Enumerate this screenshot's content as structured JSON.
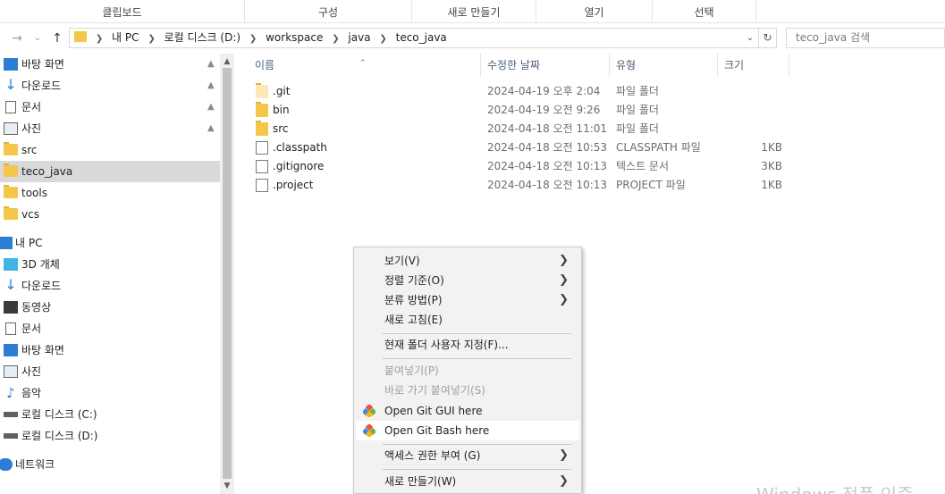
{
  "ribbon": {
    "groups": [
      "클립보드",
      "구성",
      "새로 만들기",
      "열기",
      "선택"
    ]
  },
  "address": {
    "back_icon": "left-arrow-icon",
    "forward_icon": "right-arrow-icon",
    "recent_icon": "chevron-down-icon",
    "up_icon": "up-arrow-icon",
    "crumbs": [
      "내 PC",
      "로컬 디스크 (D:)",
      "workspace",
      "java",
      "teco_java"
    ],
    "search_placeholder": "teco_java 검색"
  },
  "nav": {
    "quick_access": [
      {
        "label": "바탕 화면",
        "icon": "desktop-icon",
        "pinned": true
      },
      {
        "label": "다운로드",
        "icon": "download-icon",
        "pinned": true
      },
      {
        "label": "문서",
        "icon": "documents-icon",
        "pinned": true
      },
      {
        "label": "사진",
        "icon": "pictures-icon",
        "pinned": true
      },
      {
        "label": "src",
        "icon": "folder-icon",
        "pinned": false
      },
      {
        "label": "teco_java",
        "icon": "folder-icon",
        "pinned": false,
        "selected": true
      },
      {
        "label": "tools",
        "icon": "folder-icon",
        "pinned": false
      },
      {
        "label": "vcs",
        "icon": "folder-icon",
        "pinned": false
      }
    ],
    "this_pc": {
      "label": "내 PC",
      "icon": "computer-icon"
    },
    "this_pc_items": [
      {
        "label": "3D 개체",
        "icon": "3d-objects-icon"
      },
      {
        "label": "다운로드",
        "icon": "download-icon"
      },
      {
        "label": "동영상",
        "icon": "video-icon"
      },
      {
        "label": "문서",
        "icon": "documents-icon"
      },
      {
        "label": "바탕 화면",
        "icon": "desktop-icon"
      },
      {
        "label": "사진",
        "icon": "pictures-icon"
      },
      {
        "label": "음악",
        "icon": "music-icon"
      },
      {
        "label": "로컬 디스크 (C:)",
        "icon": "drive-icon"
      },
      {
        "label": "로컬 디스크 (D:)",
        "icon": "drive-icon"
      }
    ],
    "network": {
      "label": "네트워크",
      "icon": "network-icon"
    }
  },
  "list": {
    "columns": {
      "name": "이름",
      "modified": "수정한 날짜",
      "type": "유형",
      "size": "크기"
    },
    "rows": [
      {
        "name": ".git",
        "modified": "2024-04-19 오후 2:04",
        "type": "파일 폴더",
        "size": "",
        "kind": "folder-hidden"
      },
      {
        "name": "bin",
        "modified": "2024-04-19 오전 9:26",
        "type": "파일 폴더",
        "size": "",
        "kind": "folder"
      },
      {
        "name": "src",
        "modified": "2024-04-18 오전 11:01",
        "type": "파일 폴더",
        "size": "",
        "kind": "folder"
      },
      {
        "name": ".classpath",
        "modified": "2024-04-18 오전 10:53",
        "type": "CLASSPATH 파일",
        "size": "1KB",
        "kind": "file"
      },
      {
        "name": ".gitignore",
        "modified": "2024-04-18 오전 10:13",
        "type": "텍스트 문서",
        "size": "3KB",
        "kind": "text-file"
      },
      {
        "name": ".project",
        "modified": "2024-04-18 오전 10:13",
        "type": "PROJECT 파일",
        "size": "1KB",
        "kind": "file"
      }
    ]
  },
  "context_menu": {
    "view": "보기(V)",
    "sort_by": "정렬 기준(O)",
    "group_by": "분류 방법(P)",
    "refresh": "새로 고침(E)",
    "customize": "현재 폴더 사용자 지정(F)...",
    "paste": "붙여넣기(P)",
    "paste_shortcut": "바로 가기 붙여넣기(S)",
    "git_gui": "Open Git GUI here",
    "git_bash": "Open Git Bash here",
    "give_access": "액세스 권한 부여 (G)",
    "new": "새로 만들기(W)"
  },
  "watermark": "Windows 정품 인증"
}
